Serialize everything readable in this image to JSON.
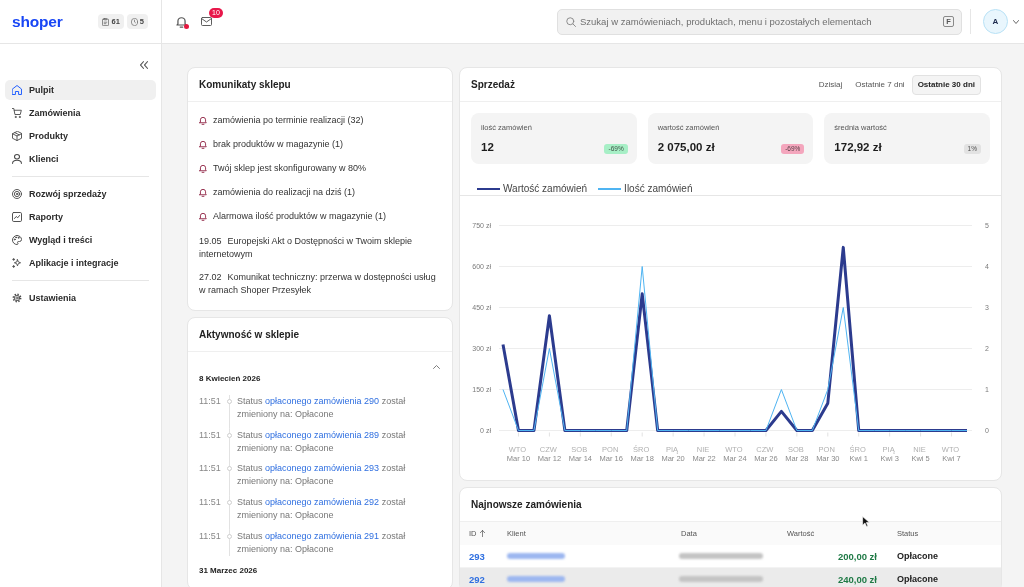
{
  "header": {
    "logo": "shoper",
    "counters": [
      {
        "kind": "tasks",
        "value": "61"
      },
      {
        "kind": "timer",
        "value": "5"
      }
    ],
    "notifications": {
      "unread": true
    },
    "messages": {
      "count": "10"
    },
    "search": {
      "placeholder": "Szukaj w zamówieniach, produktach, menu i pozostałych elementach",
      "shortcut": "F"
    },
    "user": {
      "initial": "A"
    }
  },
  "sidebar": {
    "groups": [
      {
        "items": [
          {
            "label": "Pulpit",
            "selected": true
          },
          {
            "label": "Zamówienia",
            "selected": false
          },
          {
            "label": "Produkty",
            "selected": false
          },
          {
            "label": "Klienci",
            "selected": false
          }
        ]
      },
      {
        "items": [
          {
            "label": "Rozwój sprzedaży",
            "selected": false
          },
          {
            "label": "Raporty",
            "selected": false
          },
          {
            "label": "Wygląd i treści",
            "selected": false
          },
          {
            "label": "Aplikacje i integracje",
            "selected": false
          }
        ]
      },
      {
        "items": [
          {
            "label": "Ustawienia",
            "selected": false
          }
        ]
      }
    ]
  },
  "shop_messages": {
    "title": "Komunikaty sklepu",
    "items": [
      {
        "kind": "alert",
        "text": "zamówienia po terminie realizacji (32)"
      },
      {
        "kind": "alert",
        "text": "brak produktów w magazynie (1)"
      },
      {
        "kind": "alert",
        "text": "Twój sklep jest skonfigurowany w 80%"
      },
      {
        "kind": "alert",
        "text": "zamówienia do realizacji na dziś (1)"
      },
      {
        "kind": "alert",
        "text": "Alarmowa ilość produktów w magazynie (1)"
      },
      {
        "kind": "news",
        "date": "19.05",
        "text": "Europejski Akt o Dostępności w Twoim sklepie internetowym"
      },
      {
        "kind": "news",
        "date": "27.02",
        "text": "Komunikat techniczny: przerwa w dostępności usług w ramach Shoper Przesyłek"
      }
    ]
  },
  "activity": {
    "title": "Aktywność w sklepie",
    "expanded": true,
    "groups": [
      {
        "date": "8 Kwiecień 2026",
        "entries": [
          {
            "time": "11:51",
            "before": "Status",
            "link": "opłaconego zamówienia 290",
            "after": "został zmieniony na: Opłacone"
          },
          {
            "time": "11:51",
            "before": "Status",
            "link": "opłaconego zamówienia 289",
            "after": "został zmieniony na: Opłacone"
          },
          {
            "time": "11:51",
            "before": "Status",
            "link": "opłaconego zamówienia 293",
            "after": "został zmieniony na: Opłacone"
          },
          {
            "time": "11:51",
            "before": "Status",
            "link": "opłaconego zamówienia 292",
            "after": "został zmieniony na: Opłacone"
          },
          {
            "time": "11:51",
            "before": "Status",
            "link": "opłaconego zamówienia 291",
            "after": "został zmieniony na: Opłacone"
          }
        ]
      },
      {
        "date": "31 Marzec 2026"
      }
    ]
  },
  "sales": {
    "title": "Sprzedaż",
    "ranges": [
      {
        "label": "Dzisiaj",
        "selected": false
      },
      {
        "label": "Ostatnie 7 dni",
        "selected": false
      },
      {
        "label": "Ostatnie 30 dni",
        "selected": true
      }
    ],
    "kpis": [
      {
        "label": "ilość zamówień",
        "value": "12",
        "change": "-69%",
        "color": "#a7efc6"
      },
      {
        "label": "wartość zamówień",
        "value": "2 075,00 zł",
        "change": "-69%",
        "color": "#f4a6bd"
      },
      {
        "label": "średnia wartość",
        "value": "172,92 zł",
        "change": "1%",
        "color": "#e2e2e2"
      }
    ],
    "chart_data": {
      "type": "line",
      "legend": "top",
      "grid": true,
      "categories": [
        null,
        "WTO Mar 10",
        null,
        "CZW Mar 12",
        null,
        "SOB Mar 14",
        null,
        "PON Mar 16",
        null,
        "ŚRO Mar 18",
        null,
        "PIĄ Mar 20",
        null,
        "NIE Mar 22",
        null,
        "WTO Mar 24",
        null,
        "CZW Mar 26",
        null,
        "SOB Mar 28",
        null,
        "PON Mar 30",
        null,
        "ŚRO Kwi 1",
        null,
        "PIĄ Kwi 3",
        null,
        "NIE Kwi 5",
        null,
        "WTO Kwi 7",
        null
      ],
      "ylim": [
        0,
        750
      ],
      "yticks": [
        {
          "value": 0,
          "label": "0 zł"
        },
        {
          "value": 150,
          "label": "150 zł"
        },
        {
          "value": 300,
          "label": "300 zł"
        },
        {
          "value": 450,
          "label": "450 zł"
        },
        {
          "value": 600,
          "label": "600 zł"
        },
        {
          "value": 750,
          "label": "750 zł"
        }
      ],
      "y2lim": [
        0,
        5
      ],
      "y2ticks": [
        0,
        1,
        2,
        3,
        4,
        5
      ],
      "series": [
        {
          "name": "Wartość zamówień",
          "color": "#2c3b8e",
          "values": [
            315,
            0,
            0,
            420,
            0,
            0,
            0,
            0,
            0,
            500,
            0,
            0,
            0,
            0,
            0,
            0,
            0,
            0,
            70,
            0,
            0,
            100,
            670,
            0,
            0,
            0,
            0,
            0,
            0,
            0,
            0
          ]
        },
        {
          "name": "Ilość zamówień",
          "color": "#4fb4f2",
          "axis": "y2",
          "values": [
            1,
            0,
            0,
            2,
            0,
            0,
            0,
            0,
            0,
            4,
            0,
            0,
            0,
            0,
            0,
            0,
            0,
            0,
            1,
            0,
            0,
            1,
            3,
            0,
            0,
            0,
            0,
            0,
            0,
            0,
            0
          ]
        }
      ]
    }
  },
  "latest_orders": {
    "title": "Najnowsze zamówienia",
    "columns": [
      {
        "label": "ID",
        "sorted": true
      },
      {
        "label": "Klient",
        "sorted": false
      },
      {
        "label": "Data",
        "sorted": false
      },
      {
        "label": "Wartość",
        "sorted": false
      },
      {
        "label": "Status",
        "sorted": false
      }
    ],
    "rows": [
      {
        "id": "293",
        "value": "200,00 zł",
        "status": "Opłacone",
        "hovered": false
      },
      {
        "id": "292",
        "value": "240,00 zł",
        "status": "Opłacone",
        "hovered": true
      }
    ]
  }
}
